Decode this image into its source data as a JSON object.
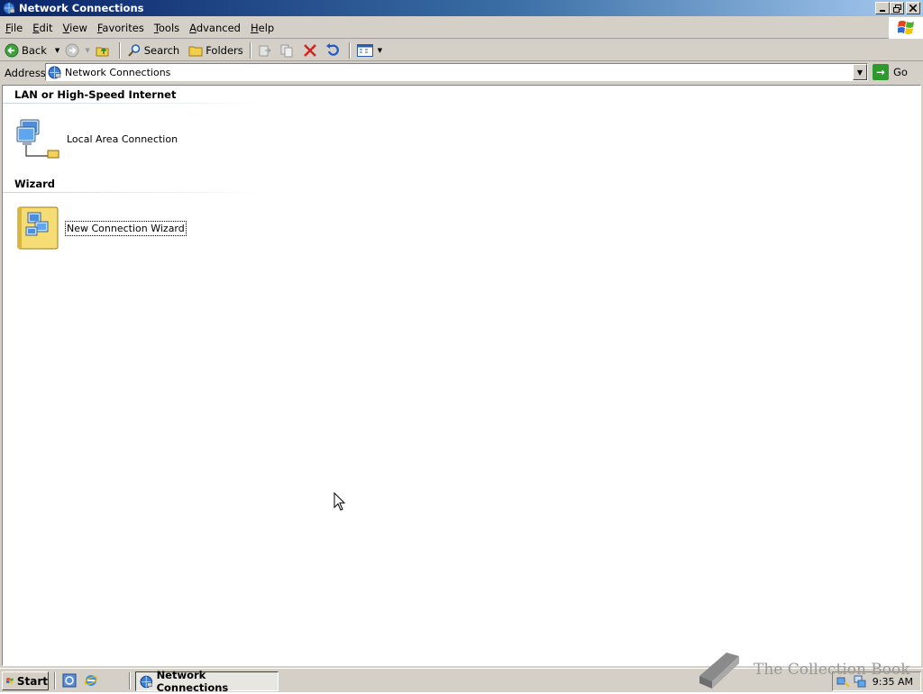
{
  "window": {
    "title": "Network Connections",
    "caption_buttons": [
      "minimize",
      "restore",
      "close"
    ]
  },
  "menu": {
    "items": [
      {
        "label": "File",
        "accel": "F",
        "rest": "ile"
      },
      {
        "label": "Edit",
        "accel": "E",
        "rest": "dit"
      },
      {
        "label": "View",
        "accel": "V",
        "rest": "iew"
      },
      {
        "label": "Favorites",
        "accel": "F",
        "rest": "avorites"
      },
      {
        "label": "Tools",
        "accel": "T",
        "rest": "ools"
      },
      {
        "label": "Advanced",
        "accel": "A",
        "rest": "dvanced"
      },
      {
        "label": "Help",
        "accel": "H",
        "rest": "elp"
      }
    ]
  },
  "toolbar": {
    "back_label": "Back",
    "search_label": "Search",
    "folders_label": "Folders"
  },
  "address": {
    "label": "Address",
    "value": "Network Connections",
    "go_label": "Go"
  },
  "content": {
    "groups": [
      {
        "header": "LAN or High-Speed Internet",
        "items": [
          {
            "label": "Local Area Connection",
            "icon": "lan-connection-icon"
          }
        ]
      },
      {
        "header": "Wizard",
        "items": [
          {
            "label": "New Connection Wizard",
            "icon": "connection-wizard-icon",
            "focused": true
          }
        ]
      }
    ]
  },
  "taskbar": {
    "start_label": "Start",
    "task_label": "Network Connections",
    "clock": "9:35 AM"
  },
  "watermark": {
    "text": "The Collection Book"
  },
  "colors": {
    "title_gradient_start": "#0a246a",
    "title_gradient_end": "#a6caf0",
    "chrome": "#d4d0c8",
    "stop_red": "#d42020",
    "go_green": "#2e9a2e"
  }
}
